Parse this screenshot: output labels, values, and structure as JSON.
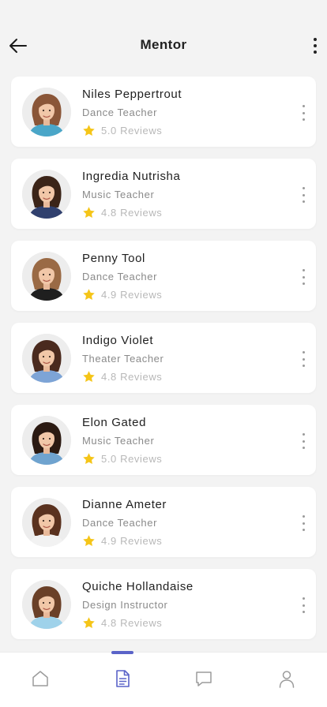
{
  "header": {
    "title": "Mentor"
  },
  "mentors": [
    {
      "name": "Niles Peppertrout",
      "role": "Dance Teacher",
      "rating": "5.0 Reviews",
      "hair": "#8a5638",
      "shirt": "#4aa6c8"
    },
    {
      "name": "Ingredia Nutrisha",
      "role": "Music Teacher",
      "rating": "4.8 Reviews",
      "hair": "#3b2418",
      "shirt": "#30406e"
    },
    {
      "name": "Penny Tool",
      "role": "Dance Teacher",
      "rating": "4.9 Reviews",
      "hair": "#9a6a45",
      "shirt": "#1f1f1f"
    },
    {
      "name": "Indigo Violet",
      "role": "Theater Teacher",
      "rating": "4.8 Reviews",
      "hair": "#4a2a1e",
      "shirt": "#7da4d6"
    },
    {
      "name": "Elon Gated",
      "role": "Music Teacher",
      "rating": "5.0 Reviews",
      "hair": "#2b1a12",
      "shirt": "#6fa3cf"
    },
    {
      "name": "Dianne Ameter",
      "role": "Dance Teacher",
      "rating": "4.9 Reviews",
      "hair": "#5a321f",
      "shirt": "#f2f2f2"
    },
    {
      "name": "Quiche Hollandaise",
      "role": "Design Instructor",
      "rating": "4.8 Reviews",
      "hair": "#6a4028",
      "shirt": "#9fd2ea"
    }
  ],
  "colors": {
    "star": "#f5c518",
    "accent": "#5a63c8"
  },
  "tabbar": {
    "tabs": [
      {
        "icon": "home-icon",
        "active": false
      },
      {
        "icon": "document-icon",
        "active": true
      },
      {
        "icon": "chat-icon",
        "active": false
      },
      {
        "icon": "profile-icon",
        "active": false
      }
    ]
  }
}
